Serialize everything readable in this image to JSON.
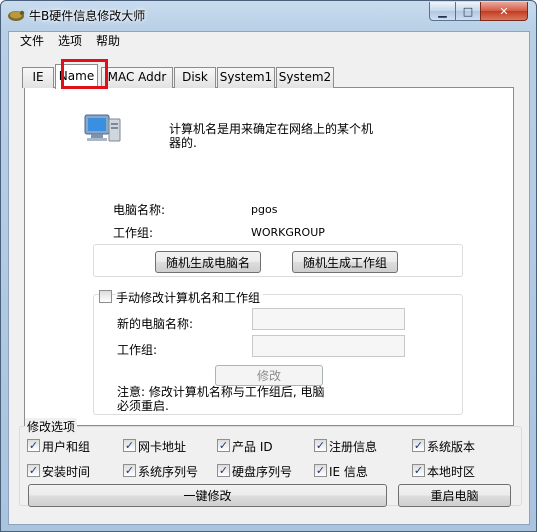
{
  "window": {
    "title": "牛B硬件信息修改大师"
  },
  "menu": [
    "文件",
    "选项",
    "帮助"
  ],
  "tabs": [
    "IE",
    "Name",
    "MAC Addr",
    "Disk",
    "System1",
    "System2"
  ],
  "name_tab": {
    "description": "计算机名是用来确定在网络上的某个机器的.",
    "computer_name_label": "电脑名称:",
    "computer_name_value": "pgos",
    "workgroup_label": "工作组:",
    "workgroup_value": "WORKGROUP",
    "random_name_button": "随机生成电脑名",
    "random_workgroup_button": "随机生成工作组",
    "manual_checkbox_label": "手动修改计算机名和工作组",
    "manual_checked": false,
    "new_name_label": "新的电脑名称:",
    "new_workgroup_label": "工作组:",
    "modify_button": "修改",
    "note": "注意: 修改计算机名称与工作组后, 电脑必须重启."
  },
  "options": {
    "legend": "修改选项",
    "items": [
      {
        "label": "用户和组",
        "checked": true
      },
      {
        "label": "网卡地址",
        "checked": true
      },
      {
        "label": "产品 ID",
        "checked": true
      },
      {
        "label": "注册信息",
        "checked": true
      },
      {
        "label": "系统版本",
        "checked": true
      },
      {
        "label": "安装时间",
        "checked": true
      },
      {
        "label": "系统序列号",
        "checked": true
      },
      {
        "label": "硬盘序列号",
        "checked": true
      },
      {
        "label": "IE 信息",
        "checked": true
      },
      {
        "label": "本地时区",
        "checked": true
      }
    ],
    "apply_button": "一键修改",
    "restart_button": "重启电脑"
  },
  "colors": {
    "highlight": "#e0101a"
  }
}
